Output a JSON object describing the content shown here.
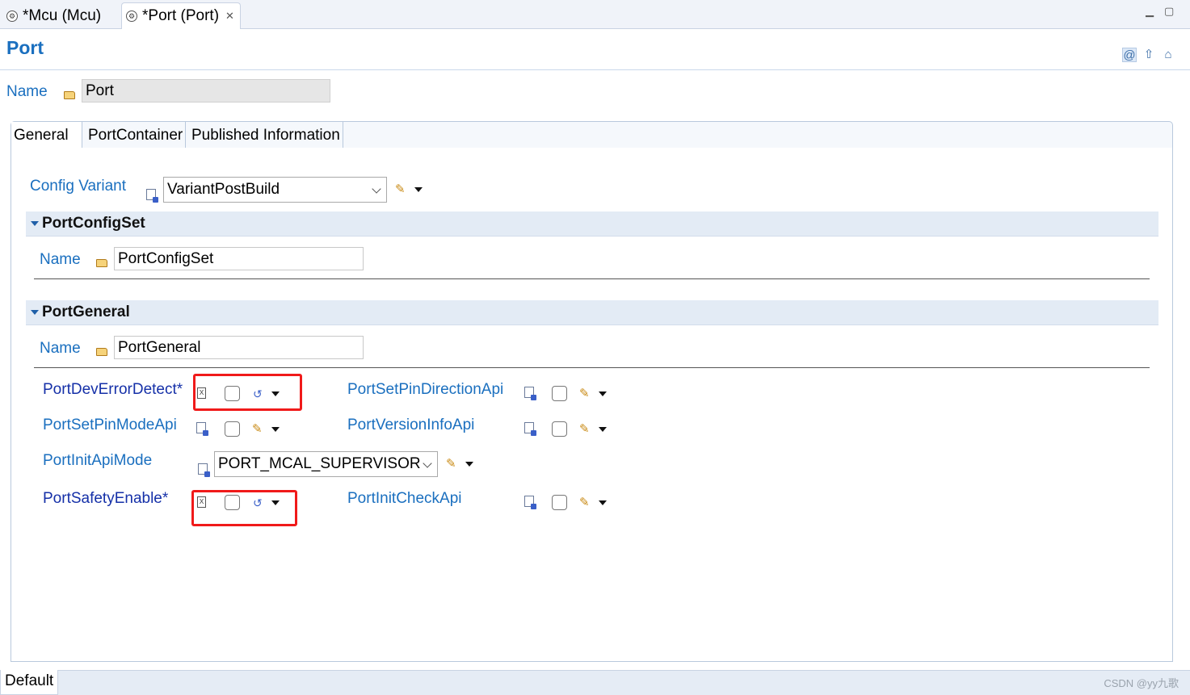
{
  "editor_tabs": [
    {
      "label": "*Mcu (Mcu)"
    },
    {
      "label": "*Port (Port)"
    }
  ],
  "header": {
    "title": "Port"
  },
  "name_field": {
    "label": "Name",
    "value": "Port"
  },
  "form_tabs": [
    "General",
    "PortContainer",
    "Published Information"
  ],
  "config_variant": {
    "label": "Config Variant",
    "value": "VariantPostBuild"
  },
  "sections": {
    "port_config_set": {
      "title": "PortConfigSet",
      "name_label": "Name",
      "name_value": "PortConfigSet"
    },
    "port_general": {
      "title": "PortGeneral",
      "name_label": "Name",
      "name_value": "PortGeneral"
    }
  },
  "params": {
    "dev_error_detect": {
      "label": "PortDevErrorDetect*",
      "checked": false
    },
    "set_pin_mode_api": {
      "label": "PortSetPinModeApi",
      "checked": false
    },
    "init_api_mode": {
      "label": "PortInitApiMode",
      "value": "PORT_MCAL_SUPERVISOR"
    },
    "safety_enable": {
      "label": "PortSafetyEnable*",
      "checked": false
    },
    "set_pin_direction_api": {
      "label": "PortSetPinDirectionApi",
      "checked": false
    },
    "version_info_api": {
      "label": "PortVersionInfoApi",
      "checked": false
    },
    "init_check_api": {
      "label": "PortInitCheckApi",
      "checked": false
    }
  },
  "bottom": {
    "tab": "Default",
    "watermark": "CSDN @yy九歌"
  },
  "colors": {
    "label_blue": "#1a6fbf",
    "dark_label": "#1530a8",
    "highlight": "#f01a1a"
  },
  "icons": [
    "gear-icon",
    "close-icon",
    "at-icon",
    "up-arrow-icon",
    "home-icon",
    "folder-icon",
    "doc-icon",
    "checkbox",
    "pencil-icon",
    "wand-icon",
    "dropdown-arrow-icon"
  ]
}
